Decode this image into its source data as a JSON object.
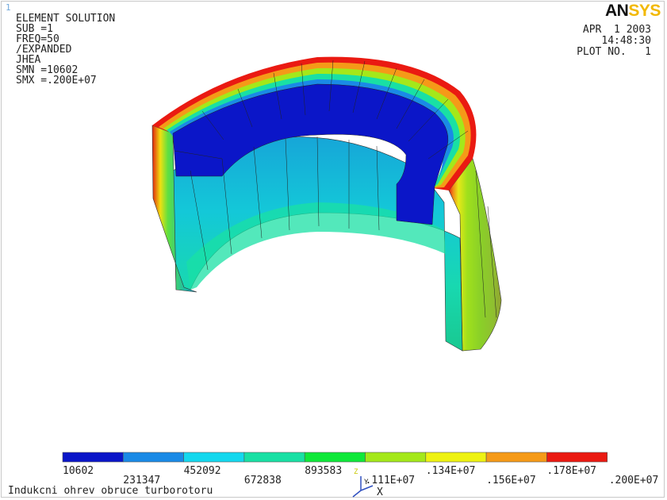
{
  "window_number": "1",
  "plot_info": [
    "ELEMENT SOLUTION",
    "",
    "SUB =1",
    "FREQ=50",
    "/EXPANDED",
    "JHEA",
    "SMN =10602",
    "SMX =.200E+07"
  ],
  "logo": {
    "part1": "AN",
    "part2": "SYS"
  },
  "stamp": [
    "APR  1 2003",
    "14:48:30",
    "PLOT NO.   1"
  ],
  "legend": {
    "colors": [
      "#0b16c8",
      "#1a8ae6",
      "#14d8ee",
      "#19e0a4",
      "#10e83a",
      "#a4e81a",
      "#eef212",
      "#f59a18",
      "#ea1a12"
    ],
    "labels": [
      "10602",
      "231347",
      "452092",
      "672838",
      "893583",
      ".111E+07",
      ".134E+07",
      ".156E+07",
      ".178E+07",
      ".200E+07"
    ]
  },
  "caption": "Indukcni ohrev obruce turborotoru",
  "triad": {
    "x_label": "X",
    "y_label": "Y",
    "z_label": "Z"
  }
}
